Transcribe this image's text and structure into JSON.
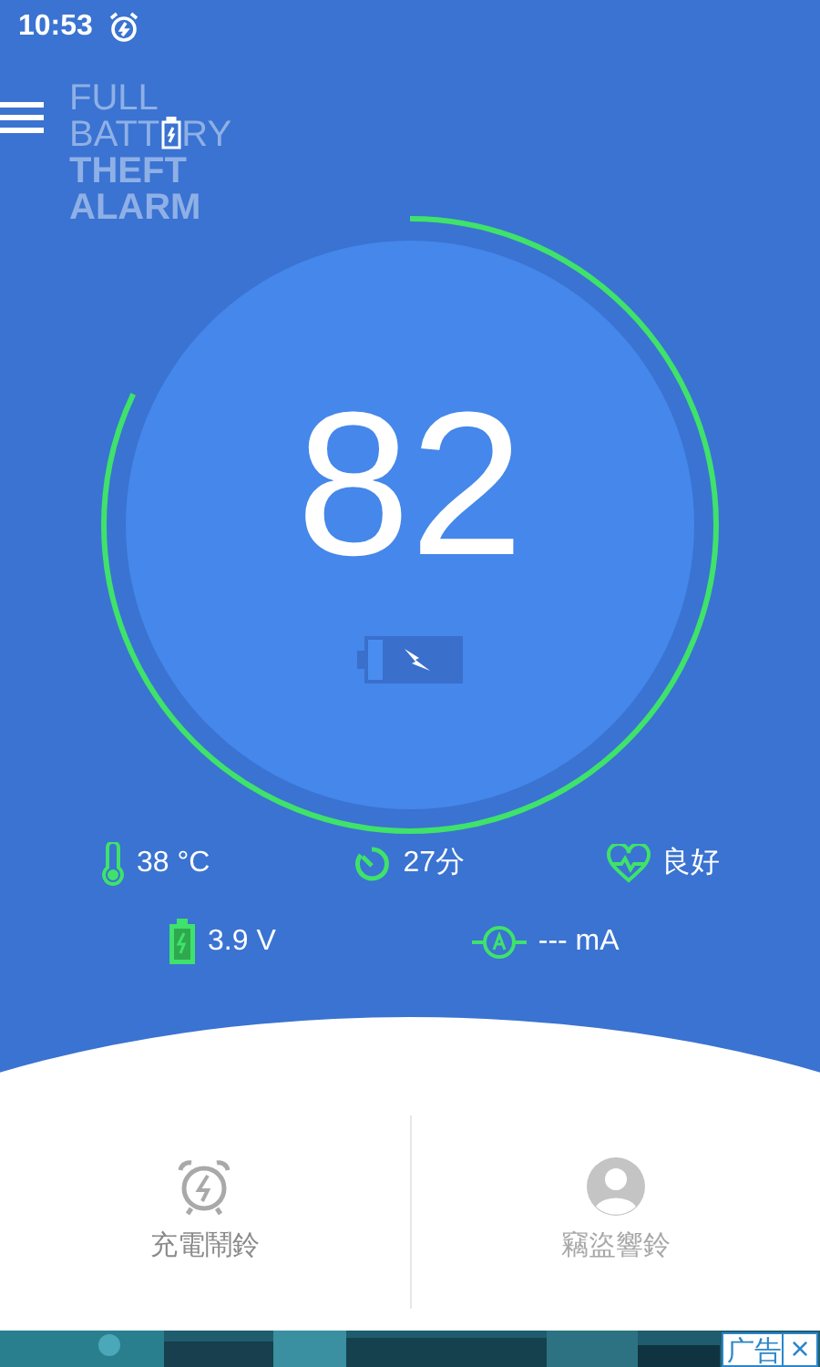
{
  "status_bar": {
    "time": "10:53"
  },
  "logo": {
    "line_1": "FULL",
    "line_2_start": "BATT",
    "line_2_end": "RY",
    "line_3": "THEFT",
    "line_4": "ALARM"
  },
  "gauge": {
    "value": "82",
    "level": 0.82,
    "charging": true
  },
  "stats": [
    {
      "kind": "temperature",
      "text": "38 °C"
    },
    {
      "kind": "timer",
      "text": "27分"
    },
    {
      "kind": "health",
      "text": "良好"
    },
    {
      "kind": "voltage",
      "text": "3.9 V"
    },
    {
      "kind": "current",
      "text": "--- mA"
    }
  ],
  "alarms": [
    {
      "kind": "charge",
      "label": "充電鬧鈴",
      "disabled": false
    },
    {
      "kind": "theft",
      "label": "竊盜響鈴",
      "disabled": true
    }
  ],
  "ad": {
    "kind": "picture",
    "badge": "广告",
    "close": "×"
  }
}
